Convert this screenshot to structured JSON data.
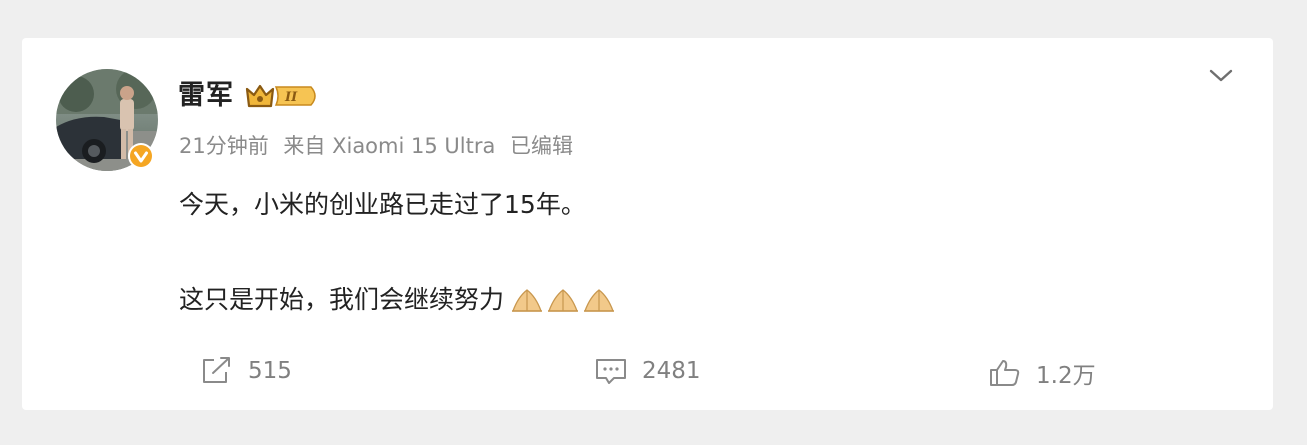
{
  "post": {
    "author": {
      "name": "雷军",
      "vip_level": "II"
    },
    "meta": {
      "time": "21分钟前",
      "source": "来自 Xiaomi 15 Ultra",
      "edited": "已编辑"
    },
    "text": {
      "line1": "今天，小米的创业路已走过了15年。",
      "line2": "这只是开始，我们会继续努力"
    },
    "emoji_count": 3,
    "actions": {
      "repost_count": "515",
      "comment_count": "2481",
      "like_count": "1.2万"
    }
  },
  "colors": {
    "background": "#efefef",
    "card": "#ffffff",
    "text_primary": "#222222",
    "text_secondary": "#8a8a8a",
    "verify_badge": "#f5a623",
    "vip_gold": "#f0b63a"
  }
}
